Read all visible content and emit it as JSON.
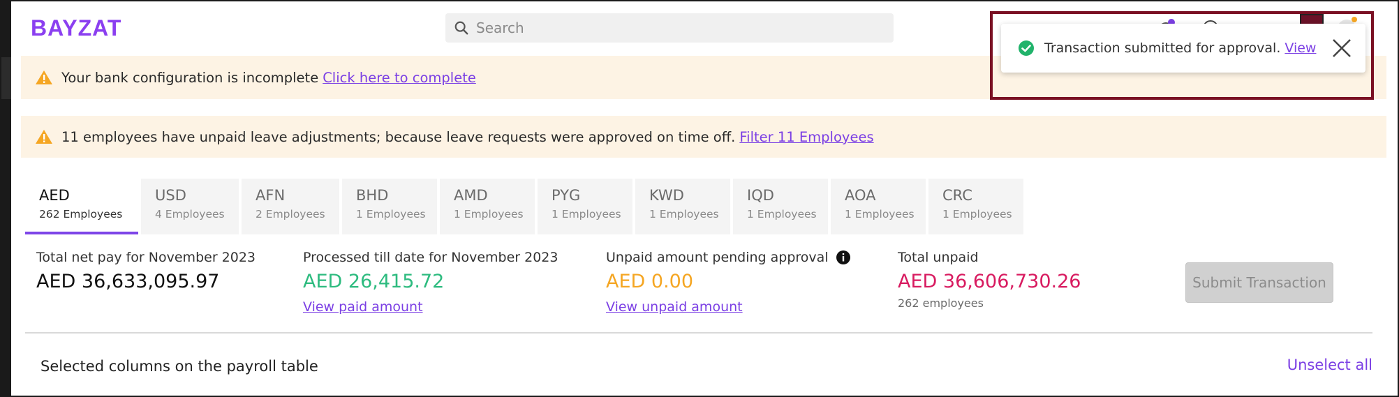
{
  "app": {
    "logo": "BAYZAT",
    "brand_color": "#8b3ff0",
    "accent": "#7b3fe4"
  },
  "search": {
    "placeholder": "Search",
    "icon": "search-icon"
  },
  "header_icons": [
    "notification-icon",
    "globe-icon",
    "avatar",
    "settings-icon"
  ],
  "banners": [
    {
      "text": "Your bank configuration is incomplete",
      "link": "Click here to complete",
      "icon": "warning-icon"
    },
    {
      "text": "11 employees have unpaid leave adjustments; because leave requests were approved on time off.",
      "link": "Filter 11 Employees",
      "icon": "warning-icon"
    }
  ],
  "currency_tabs": [
    {
      "code": "AED",
      "count": "262 Employees",
      "active": true
    },
    {
      "code": "USD",
      "count": "4 Employees"
    },
    {
      "code": "AFN",
      "count": "2 Employees"
    },
    {
      "code": "BHD",
      "count": "1 Employees"
    },
    {
      "code": "AMD",
      "count": "1 Employees"
    },
    {
      "code": "PYG",
      "count": "1 Employees"
    },
    {
      "code": "KWD",
      "count": "1 Employees"
    },
    {
      "code": "IQD",
      "count": "1 Employees"
    },
    {
      "code": "AOA",
      "count": "1 Employees"
    },
    {
      "code": "CRC",
      "count": "1 Employees"
    }
  ],
  "summary": {
    "total_net_pay": {
      "label": "Total net pay for November 2023",
      "value": "AED 36,633,095.97",
      "color": "#111111"
    },
    "processed": {
      "label": "Processed till date for November 2023",
      "value": "AED 26,415.72",
      "link": "View paid amount",
      "color": "#2dbb7f"
    },
    "pending": {
      "label": "Unpaid amount pending approval",
      "value": "AED 0.00",
      "link": "View unpaid amount",
      "color": "#f5a623",
      "icon": "info-icon"
    },
    "total_unpaid": {
      "label": "Total unpaid",
      "value": "AED 36,606,730.26",
      "sub": "262 employees",
      "color": "#d81b60"
    },
    "submit_label": "Submit Transaction"
  },
  "column_selection": {
    "title": "Selected columns on the payroll table",
    "unselect_label": "Unselect all"
  },
  "toast": {
    "message": "Transaction submitted for approval.",
    "link": "View",
    "icon": "check-circle-icon",
    "highlight_color": "#7a1023"
  }
}
